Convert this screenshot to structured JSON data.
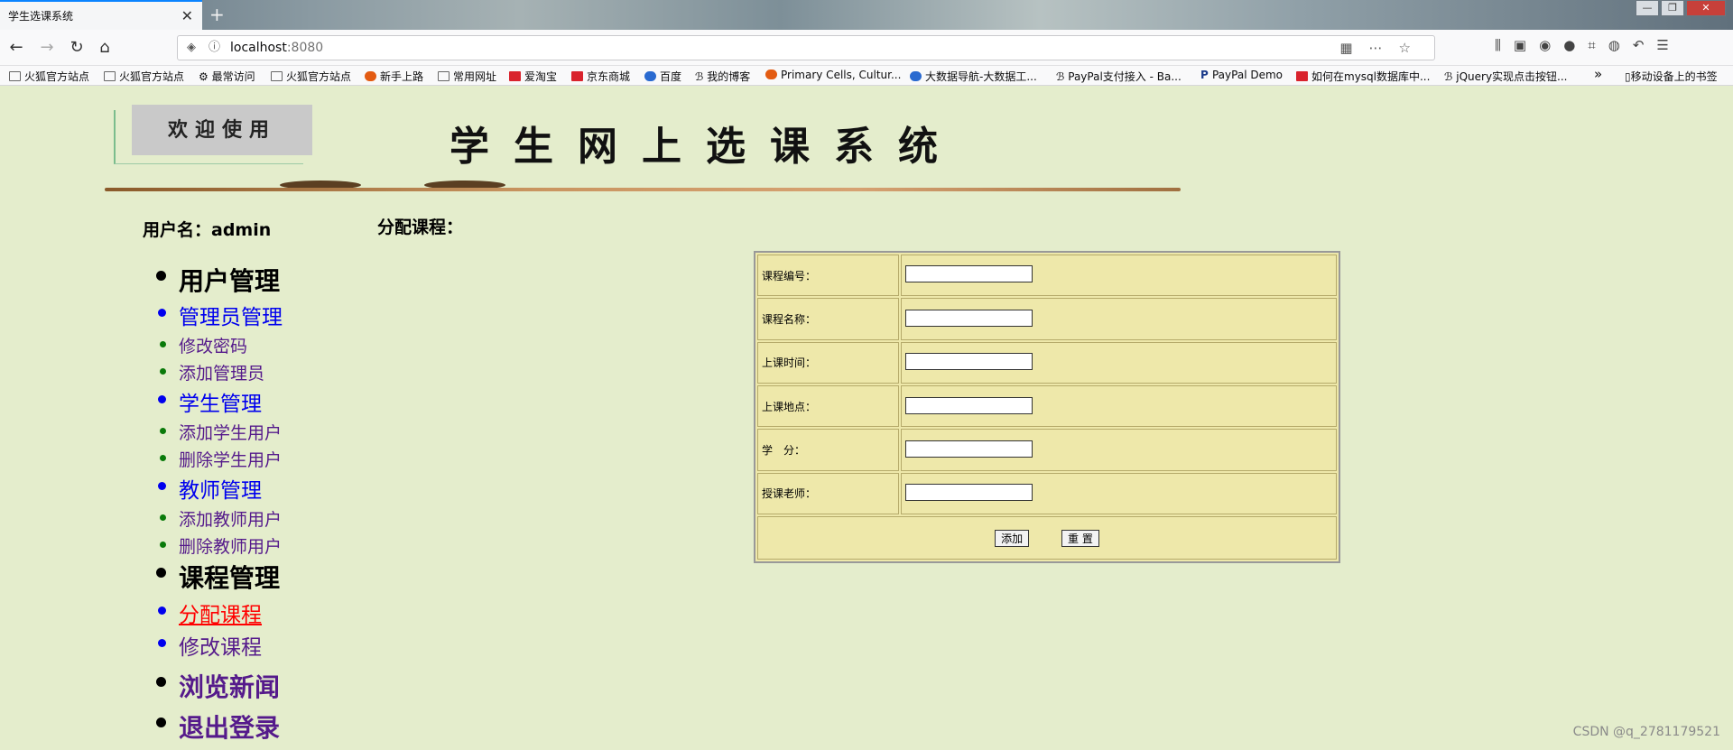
{
  "browser": {
    "tab_title": "学生选课系统",
    "tab_close": "✕",
    "new_tab": "+",
    "url_host": "localhost",
    "url_port": ":8080",
    "window_controls": [
      "—",
      "❐",
      "✕"
    ],
    "bookmarks": [
      {
        "label": "火狐官方站点",
        "icon": "folder-icon"
      },
      {
        "label": "火狐官方站点",
        "icon": "folder-icon"
      },
      {
        "label": "最常访问",
        "icon": "gear-icon"
      },
      {
        "label": "火狐官方站点",
        "icon": "folder-icon"
      },
      {
        "label": "新手上路",
        "icon": "firefox-icon"
      },
      {
        "label": "常用网址",
        "icon": "folder-icon"
      },
      {
        "label": "爱淘宝",
        "icon": "taobao-icon"
      },
      {
        "label": "京东商城",
        "icon": "jd-icon"
      },
      {
        "label": "百度",
        "icon": "baidu-icon"
      },
      {
        "label": "我的博客",
        "icon": "blog-icon"
      },
      {
        "label": "Primary Cells, Cultur...",
        "icon": "site-icon"
      },
      {
        "label": "大数据导航-大数据工...",
        "icon": "site-icon"
      },
      {
        "label": "PayPal支付接入 - Ba...",
        "icon": "site-icon"
      },
      {
        "label": "PayPal Demo",
        "icon": "paypal-icon"
      },
      {
        "label": "如何在mysql数据库中...",
        "icon": "csdn-icon"
      },
      {
        "label": "jQuery实现点击按钮...",
        "icon": "site-icon"
      }
    ],
    "bookmarks_overflow": "»",
    "mobile_bookmarks": "移动设备上的书签"
  },
  "header": {
    "welcome_text": "欢迎使用",
    "site_title": "学生网上选课系统"
  },
  "user": {
    "label": "用户名：admin"
  },
  "section_title": "分配课程：",
  "menu": [
    {
      "level": 1,
      "label": "用户管理"
    },
    {
      "level": 2,
      "label": "管理员管理"
    },
    {
      "level": 3,
      "label": "修改密码"
    },
    {
      "level": 3,
      "label": "添加管理员"
    },
    {
      "level": 2,
      "label": "学生管理"
    },
    {
      "level": 3,
      "label": "添加学生用户"
    },
    {
      "level": 3,
      "label": "删除学生用户"
    },
    {
      "level": 2,
      "label": "教师管理"
    },
    {
      "level": 3,
      "label": "添加教师用户"
    },
    {
      "level": 3,
      "label": "删除教师用户"
    },
    {
      "level": 1,
      "label": "课程管理"
    },
    {
      "level": 2,
      "label": "分配课程",
      "active": true
    },
    {
      "level": 2,
      "label": "修改课程",
      "visited": true
    },
    {
      "level": 1,
      "label": "浏览新闻",
      "visited": true
    },
    {
      "level": 1,
      "label": "退出登录",
      "visited": true
    }
  ],
  "form": {
    "fields": [
      {
        "label": "课程编号：",
        "value": ""
      },
      {
        "label": "课程名称：",
        "value": ""
      },
      {
        "label": "上课时间：",
        "value": ""
      },
      {
        "label": "上课地点：",
        "value": ""
      },
      {
        "label": "学　分：",
        "value": ""
      },
      {
        "label": "授课老师：",
        "value": ""
      }
    ],
    "submit_label": "添加",
    "reset_label": "重 置"
  },
  "watermark": "CSDN @q_2781179521",
  "colors": {
    "page_bg": "#e4edcc",
    "table_bg": "#eee8aa",
    "link": "#0000ee",
    "visited": "#551a8b",
    "active": "#ff0000"
  }
}
